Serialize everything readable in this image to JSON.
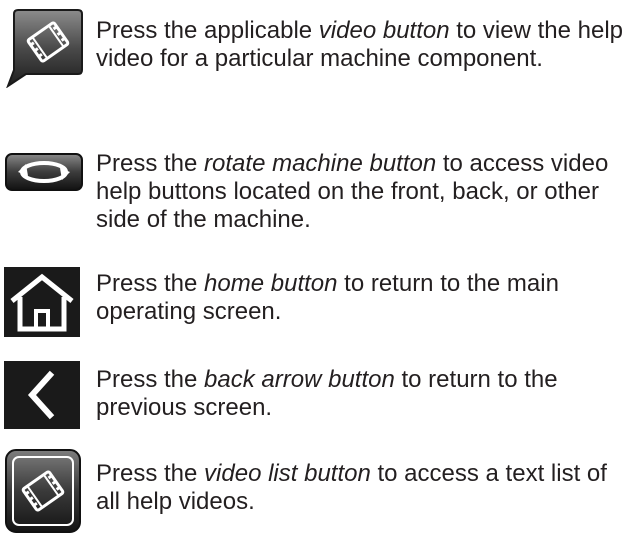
{
  "items": [
    {
      "icon": "video-button-icon",
      "before": "Press the applicable ",
      "emphasis": "video button",
      "after": " to view the help video for a particular machine component."
    },
    {
      "icon": "rotate-machine-icon",
      "before": "Press the ",
      "emphasis": "rotate machine button",
      "after": " to access video help buttons located on the front, back, or other side of the machine."
    },
    {
      "icon": "home-icon",
      "before": "Press the ",
      "emphasis": "home button",
      "after": " to return to the main operating screen."
    },
    {
      "icon": "back-arrow-icon",
      "before": "Press the ",
      "emphasis": "back arrow button",
      "after": " to return to the previous screen."
    },
    {
      "icon": "video-list-icon",
      "before": "Press the ",
      "emphasis": "video list button",
      "after": " to access a text list of all help videos."
    }
  ]
}
